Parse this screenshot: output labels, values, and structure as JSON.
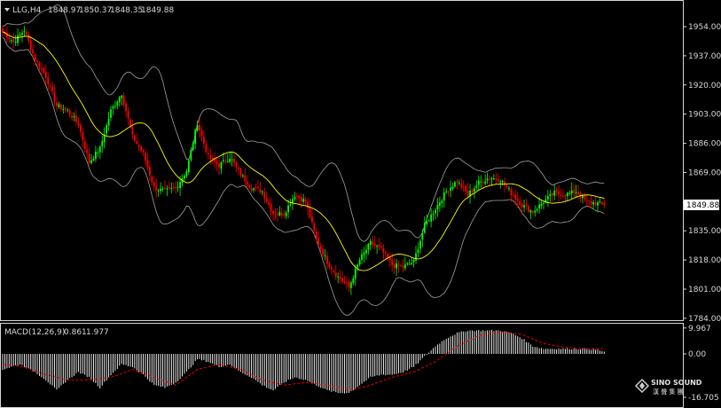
{
  "header": {
    "symbol": "LLG,H4",
    "ohlc": [
      "1848.97",
      "1850.37",
      "1848.35",
      "1849.88"
    ]
  },
  "current_price_label": "1849.88",
  "macd_header": {
    "name": "MACD(12,26,9)",
    "value1": "0.861",
    "value2": "1.977"
  },
  "watermark": {
    "brand": "SINO SOUND",
    "sub": "漢 聲 集 團"
  },
  "colors": {
    "background": "#000000",
    "bull": "#00ff00",
    "bear": "#ff0000",
    "ma": "#ffff00",
    "bands": "#a0a0a0",
    "signal": "#ff0000",
    "histogram": "#ffffff",
    "axis_text": "#d8d8d8"
  },
  "chart_data": [
    {
      "type": "candlestick",
      "title": "LLG,H4",
      "y_ticks": [
        "1954.00",
        "1937.00",
        "1920.00",
        "1903.00",
        "1886.00",
        "1869.00",
        "1835.00",
        "1818.00",
        "1801.00",
        "1784.00"
      ],
      "ylim": [
        1784,
        1959
      ],
      "last_price": 1849.88,
      "indicators": [
        "Moving average",
        "Bollinger bands"
      ],
      "close_trace": [
        [
          0,
          1951
        ],
        [
          5,
          1945
        ],
        [
          10,
          1952
        ],
        [
          15,
          1935
        ],
        [
          20,
          1925
        ],
        [
          25,
          1908
        ],
        [
          30,
          1905
        ],
        [
          35,
          1897
        ],
        [
          40,
          1875
        ],
        [
          45,
          1883
        ],
        [
          50,
          1905
        ],
        [
          55,
          1915
        ],
        [
          60,
          1890
        ],
        [
          65,
          1880
        ],
        [
          70,
          1860
        ],
        [
          75,
          1858
        ],
        [
          80,
          1860
        ],
        [
          85,
          1870
        ],
        [
          90,
          1898
        ],
        [
          95,
          1878
        ],
        [
          100,
          1873
        ],
        [
          105,
          1878
        ],
        [
          110,
          1868
        ],
        [
          115,
          1860
        ],
        [
          120,
          1858
        ],
        [
          125,
          1845
        ],
        [
          130,
          1845
        ],
        [
          135,
          1856
        ],
        [
          140,
          1852
        ],
        [
          145,
          1830
        ],
        [
          150,
          1817
        ],
        [
          155,
          1808
        ],
        [
          160,
          1802
        ],
        [
          165,
          1818
        ],
        [
          170,
          1828
        ],
        [
          175,
          1824
        ],
        [
          180,
          1815
        ],
        [
          185,
          1814
        ],
        [
          190,
          1817
        ],
        [
          195,
          1838
        ],
        [
          200,
          1848
        ],
        [
          205,
          1858
        ],
        [
          210,
          1864
        ],
        [
          215,
          1856
        ],
        [
          220,
          1863
        ],
        [
          225,
          1866
        ],
        [
          230,
          1865
        ],
        [
          235,
          1857
        ],
        [
          240,
          1850
        ],
        [
          245,
          1846
        ],
        [
          250,
          1852
        ],
        [
          255,
          1857
        ],
        [
          260,
          1856
        ],
        [
          265,
          1858
        ],
        [
          270,
          1852
        ],
        [
          275,
          1851
        ],
        [
          278,
          1849.88
        ]
      ]
    },
    {
      "type": "bar",
      "title": "MACD(12,26,9)",
      "y_ticks": [
        "9.967",
        "0.00",
        "-16.705"
      ],
      "ylim": [
        -16.705,
        9.967
      ],
      "macd_main": 0.861,
      "signal": 1.977,
      "macd_trace": [
        [
          0,
          -6
        ],
        [
          8,
          -4
        ],
        [
          15,
          -7
        ],
        [
          20,
          -10
        ],
        [
          25,
          -14
        ],
        [
          30,
          -10
        ],
        [
          35,
          -7
        ],
        [
          40,
          -9
        ],
        [
          45,
          -13
        ],
        [
          50,
          -8
        ],
        [
          55,
          -4
        ],
        [
          60,
          -5
        ],
        [
          65,
          -8
        ],
        [
          70,
          -12
        ],
        [
          75,
          -13
        ],
        [
          80,
          -11
        ],
        [
          85,
          -7
        ],
        [
          90,
          -2
        ],
        [
          95,
          -3
        ],
        [
          100,
          -5
        ],
        [
          105,
          -4
        ],
        [
          110,
          -7
        ],
        [
          115,
          -9
        ],
        [
          120,
          -12
        ],
        [
          125,
          -14
        ],
        [
          130,
          -11
        ],
        [
          135,
          -9
        ],
        [
          140,
          -10
        ],
        [
          145,
          -12
        ],
        [
          150,
          -14
        ],
        [
          155,
          -15
        ],
        [
          160,
          -15
        ],
        [
          165,
          -12
        ],
        [
          170,
          -9
        ],
        [
          175,
          -8
        ],
        [
          180,
          -8
        ],
        [
          185,
          -7
        ],
        [
          190,
          -5
        ],
        [
          195,
          -1
        ],
        [
          200,
          3
        ],
        [
          205,
          6
        ],
        [
          210,
          8
        ],
        [
          215,
          9
        ],
        [
          220,
          9
        ],
        [
          225,
          9
        ],
        [
          230,
          9
        ],
        [
          235,
          8
        ],
        [
          240,
          6
        ],
        [
          245,
          3
        ],
        [
          250,
          2
        ],
        [
          255,
          2
        ],
        [
          260,
          2
        ],
        [
          265,
          2
        ],
        [
          270,
          2
        ],
        [
          275,
          1.5
        ],
        [
          278,
          0.861
        ]
      ],
      "signal_trace": [
        [
          0,
          -4
        ],
        [
          10,
          -5
        ],
        [
          20,
          -8
        ],
        [
          30,
          -10
        ],
        [
          40,
          -10
        ],
        [
          50,
          -9
        ],
        [
          60,
          -6
        ],
        [
          70,
          -9
        ],
        [
          80,
          -12
        ],
        [
          90,
          -6
        ],
        [
          100,
          -4
        ],
        [
          110,
          -6
        ],
        [
          120,
          -10
        ],
        [
          130,
          -12
        ],
        [
          140,
          -11
        ],
        [
          150,
          -12
        ],
        [
          160,
          -14
        ],
        [
          170,
          -12
        ],
        [
          180,
          -9
        ],
        [
          190,
          -7
        ],
        [
          200,
          -3
        ],
        [
          210,
          3
        ],
        [
          220,
          7
        ],
        [
          230,
          8.5
        ],
        [
          240,
          7.5
        ],
        [
          250,
          4
        ],
        [
          260,
          2.5
        ],
        [
          270,
          2
        ],
        [
          278,
          1.977
        ]
      ]
    }
  ]
}
